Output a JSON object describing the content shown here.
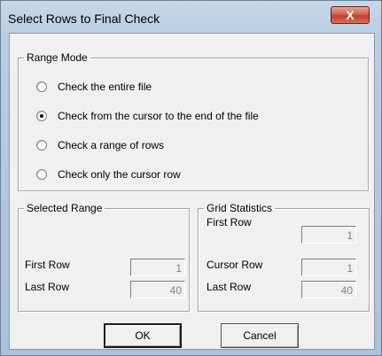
{
  "window": {
    "title": "Select Rows to Final Check",
    "close_symbol": "X"
  },
  "range_mode": {
    "legend": "Range Mode",
    "options": [
      {
        "label": "Check the entire file",
        "checked": false
      },
      {
        "label": "Check from the cursor to the end of the file",
        "checked": true
      },
      {
        "label": "Check a range of rows",
        "checked": false
      },
      {
        "label": "Check only the cursor row",
        "checked": false
      }
    ]
  },
  "selected_range": {
    "legend": "Selected Range",
    "first_row_label": "First Row",
    "first_row_value": "1",
    "last_row_label": "Last Row",
    "last_row_value": "40"
  },
  "grid_statistics": {
    "legend": "Grid Statistics",
    "first_row_label": "First Row",
    "first_row_value": "1",
    "cursor_row_label": "Cursor Row",
    "cursor_row_value": "1",
    "last_row_label": "Last Row",
    "last_row_value": "40"
  },
  "buttons": {
    "ok": "OK",
    "cancel": "Cancel"
  }
}
